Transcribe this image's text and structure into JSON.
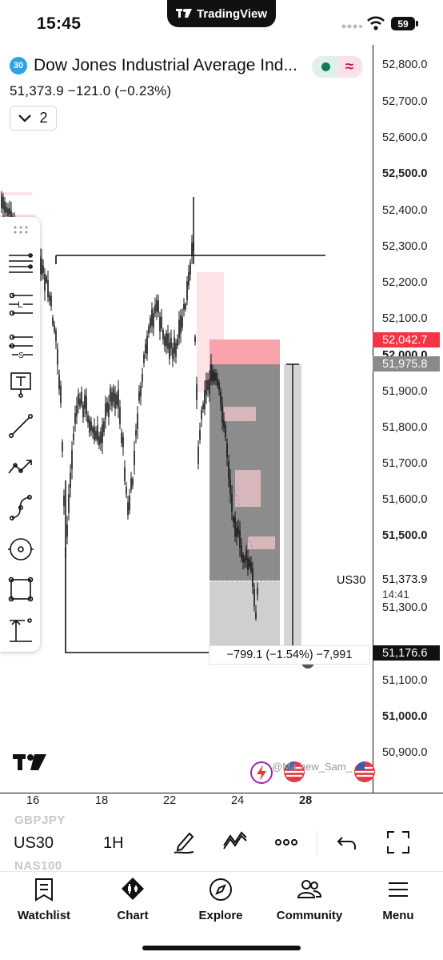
{
  "status_bar": {
    "time": "15:45",
    "app_banner": "TradingView",
    "battery": "59"
  },
  "header": {
    "badge": "30",
    "title": "Dow Jones Industrial Average Ind...",
    "quote": "51,373.9  −121.0 (−0.23%)",
    "indicator_count": "2",
    "market_status_colors": {
      "dot": "#0f7a5a",
      "wave": "#c2185b"
    }
  },
  "price_scale": {
    "ticks": [
      {
        "label": "52,800.0",
        "bold": false
      },
      {
        "label": "52,700.0",
        "bold": false
      },
      {
        "label": "52,600.0",
        "bold": false
      },
      {
        "label": "52,500.0",
        "bold": true
      },
      {
        "label": "52,400.0",
        "bold": false
      },
      {
        "label": "52,300.0",
        "bold": false
      },
      {
        "label": "52,200.0",
        "bold": false
      },
      {
        "label": "52,100.0",
        "bold": false
      },
      {
        "label": "51,900.0",
        "bold": false
      },
      {
        "label": "51,800.0",
        "bold": false
      },
      {
        "label": "51,700.0",
        "bold": false
      },
      {
        "label": "51,600.0",
        "bold": false
      },
      {
        "label": "51,500.0",
        "bold": true
      },
      {
        "label": "51,300.0",
        "bold": false
      },
      {
        "label": "51,100.0",
        "bold": false
      },
      {
        "label": "51,000.0",
        "bold": true
      },
      {
        "label": "50,900.0",
        "bold": false
      }
    ],
    "tag_upper": "52,042.7",
    "tag_mid": "51,975.8",
    "tag_lower": "51,176.6",
    "last_price": "51,373.9",
    "countdown": "14:41",
    "symbol_label": "US30",
    "colors": {
      "upper": "#f23645",
      "mid": "#8a8a8a",
      "lower": "#111111"
    }
  },
  "measure": {
    "label": "−799.1 (−1.54%) −7,991"
  },
  "watermark": {
    "user": "@Ma  hew_Sam_"
  },
  "time_axis": {
    "labels": [
      "16",
      "18",
      "22",
      "24",
      "28"
    ],
    "bold_label": "28"
  },
  "toolbar": {
    "ghost_prev": "GBPJPY",
    "symbol": "US30",
    "ghost_next": "NAS100",
    "interval": "1H",
    "icons": [
      "draw-icon",
      "indicators-icon",
      "more-icon",
      "undo-icon",
      "fullscreen-icon"
    ]
  },
  "nav": {
    "items": [
      {
        "label": "Watchlist",
        "icon": "watchlist-icon"
      },
      {
        "label": "Chart",
        "icon": "chart-icon"
      },
      {
        "label": "Explore",
        "icon": "compass-icon"
      },
      {
        "label": "Community",
        "icon": "community-icon"
      },
      {
        "label": "Menu",
        "icon": "menu-icon"
      }
    ]
  },
  "tools": [
    "drag-handle-icon",
    "horizontal-lines-icon",
    "long-position-icon",
    "short-position-icon",
    "text-icon",
    "trend-line-icon",
    "arrow-line-icon",
    "curve-icon",
    "circle-icon",
    "rectangle-icon",
    "measure-icon"
  ]
}
